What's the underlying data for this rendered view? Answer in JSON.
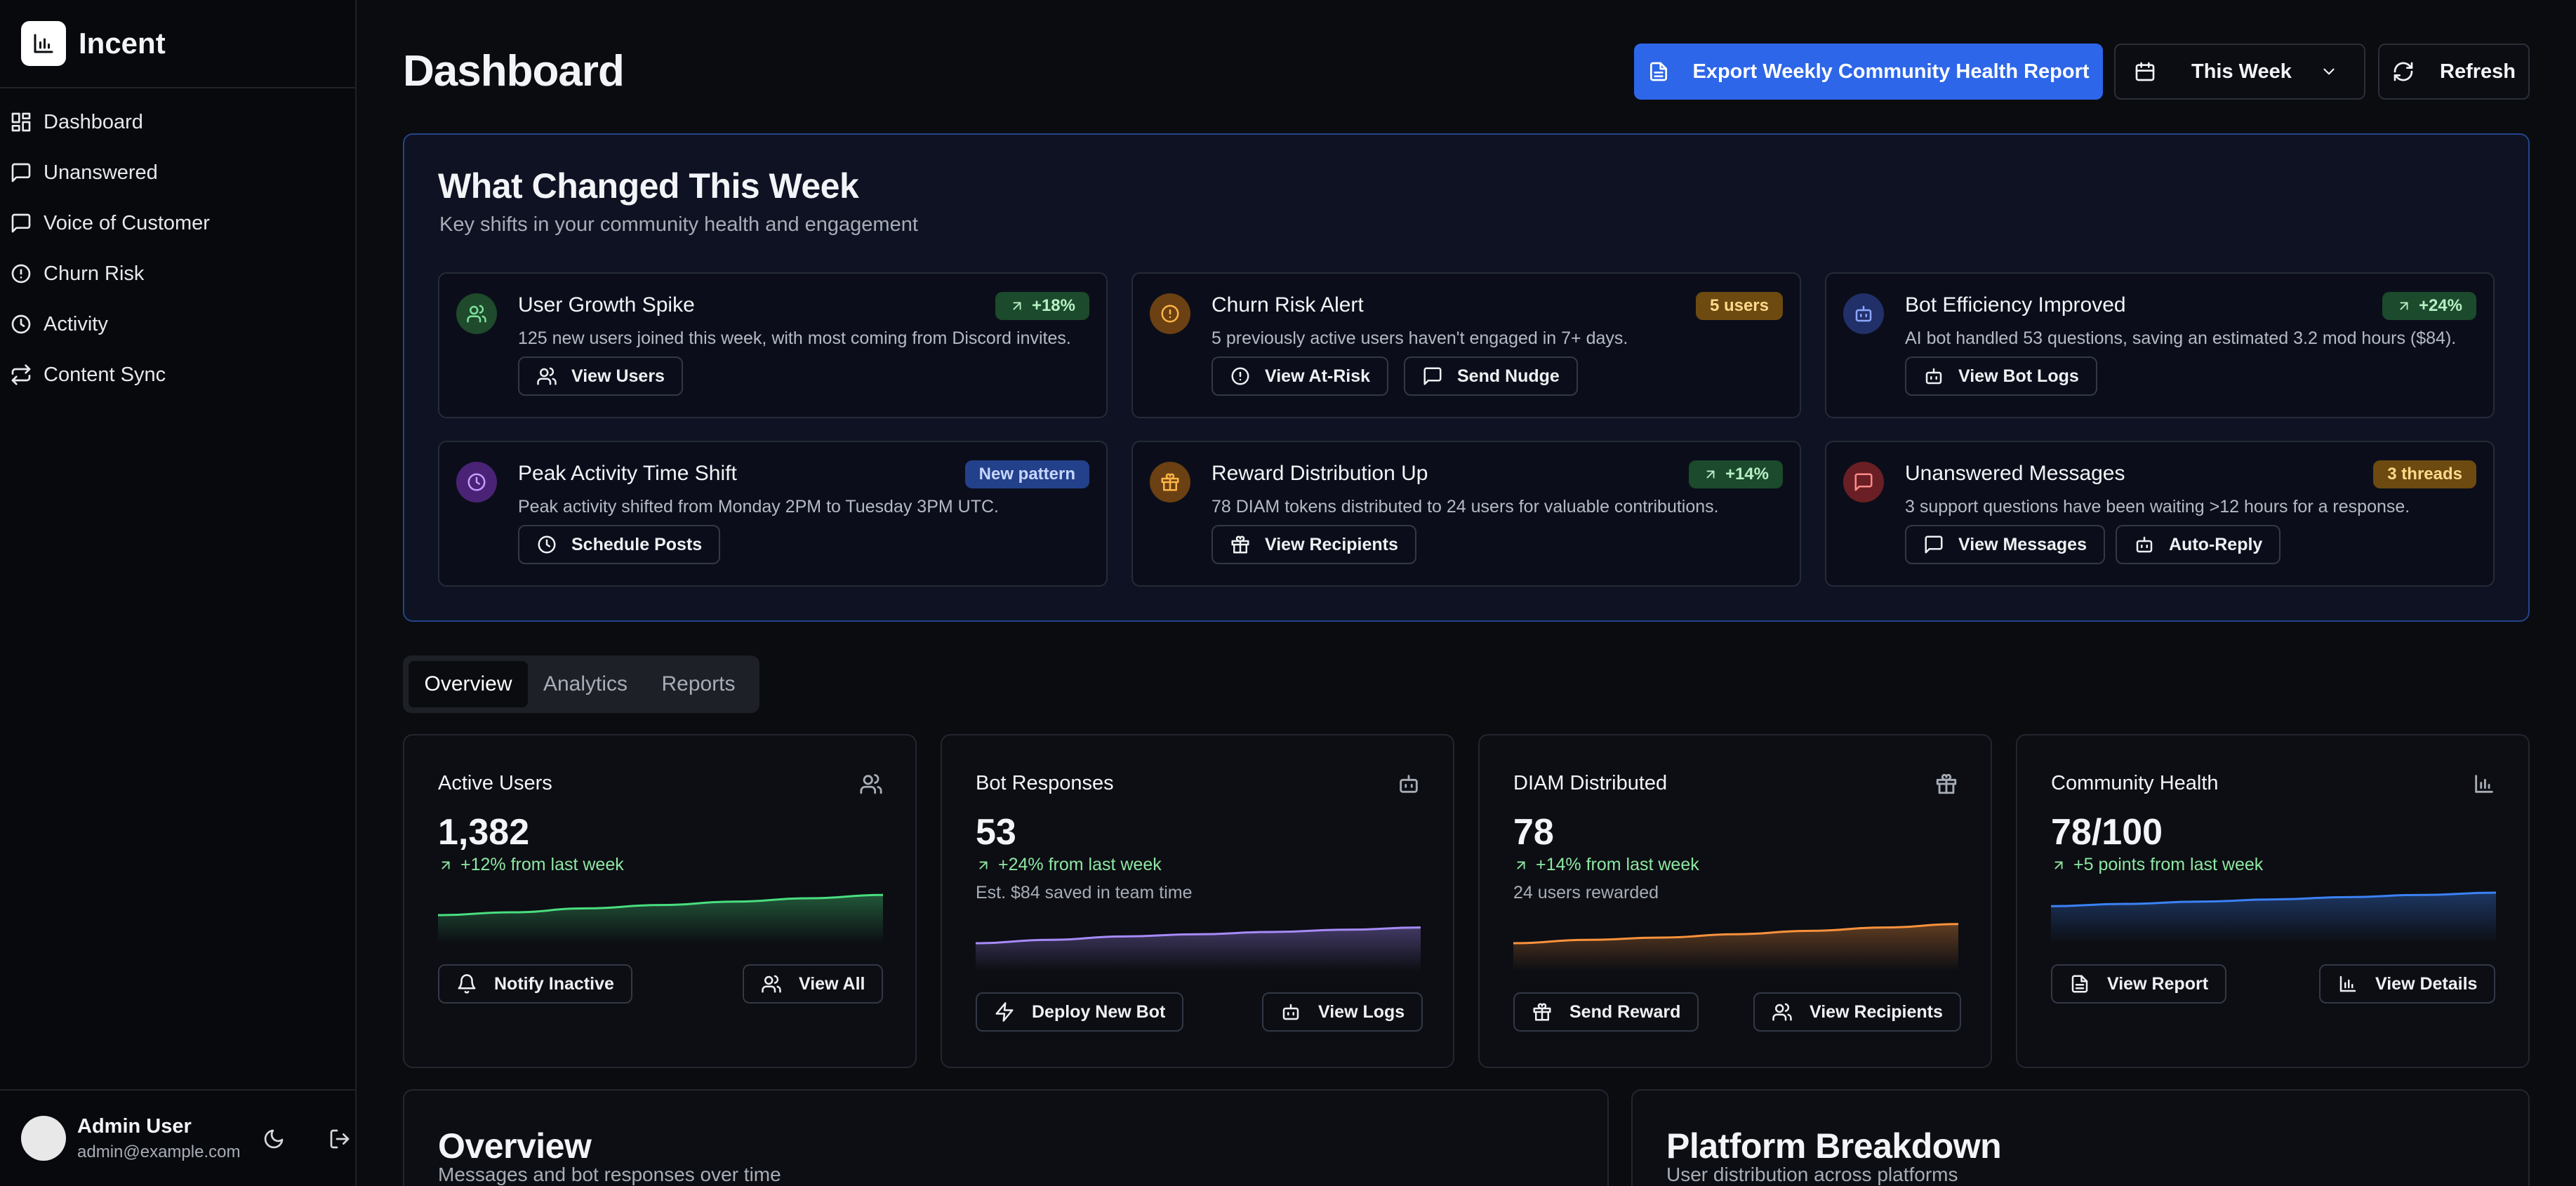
{
  "app": {
    "name": "Incent"
  },
  "colors": {
    "accent": "#2d66e8",
    "positive": "#8ee6a2",
    "background": "#0a0c10"
  },
  "sidebar": {
    "items": [
      {
        "label": "Dashboard",
        "icon": "dashboard-icon"
      },
      {
        "label": "Unanswered",
        "icon": "message-icon"
      },
      {
        "label": "Voice of Customer",
        "icon": "message-icon"
      },
      {
        "label": "Churn Risk",
        "icon": "alert-icon"
      },
      {
        "label": "Activity",
        "icon": "clock-icon"
      },
      {
        "label": "Content Sync",
        "icon": "sync-icon"
      }
    ],
    "user": {
      "name": "Admin User",
      "email": "admin@example.com"
    }
  },
  "header": {
    "title": "Dashboard",
    "export_label": "Export Weekly Community Health Report",
    "range_label": "This Week",
    "refresh_label": "Refresh"
  },
  "changes": {
    "title": "What Changed This Week",
    "subtitle": "Key shifts in your community health and engagement",
    "cards": [
      {
        "title": "User Growth Spike",
        "badge": "+18%",
        "desc": "125 new users joined this week, with most coming from Discord invites.",
        "actions": [
          "View Users"
        ]
      },
      {
        "title": "Churn Risk Alert",
        "badge": "5 users",
        "desc": "5 previously active users haven't engaged in 7+ days.",
        "actions": [
          "View At-Risk",
          "Send Nudge"
        ]
      },
      {
        "title": "Bot Efficiency Improved",
        "badge": "+24%",
        "desc": "AI bot handled 53 questions, saving an estimated 3.2 mod hours ($84).",
        "actions": [
          "View Bot Logs"
        ]
      },
      {
        "title": "Peak Activity Time Shift",
        "badge": "New pattern",
        "desc": "Peak activity shifted from Monday 2PM to Tuesday 3PM UTC.",
        "actions": [
          "Schedule Posts"
        ]
      },
      {
        "title": "Reward Distribution Up",
        "badge": "+14%",
        "desc": "78 DIAM tokens distributed to 24 users for valuable contributions.",
        "actions": [
          "View Recipients"
        ]
      },
      {
        "title": "Unanswered Messages",
        "badge": "3 threads",
        "desc": "3 support questions have been waiting >12 hours for a response.",
        "actions": [
          "View Messages",
          "Auto-Reply"
        ]
      }
    ]
  },
  "tabs": [
    "Overview",
    "Analytics",
    "Reports"
  ],
  "stats": [
    {
      "title": "Active Users",
      "value": "1,382",
      "change": "+12% from last week",
      "sub": "",
      "trend": [
        0.5,
        0.55,
        0.62,
        0.68,
        0.74,
        0.8,
        0.86
      ],
      "color": "#4ade80",
      "actions": [
        "Notify Inactive",
        "View All"
      ]
    },
    {
      "title": "Bot Responses",
      "value": "53",
      "change": "+24% from last week",
      "sub": "Est. $84 saved in team time",
      "trend": [
        0.5,
        0.56,
        0.62,
        0.66,
        0.7,
        0.74,
        0.78
      ],
      "color": "#a78bfa",
      "actions": [
        "Deploy New Bot",
        "View Logs"
      ]
    },
    {
      "title": "DIAM Distributed",
      "value": "78",
      "change": "+14% from last week",
      "sub": "24 users rewarded",
      "trend": [
        0.5,
        0.56,
        0.6,
        0.66,
        0.72,
        0.78,
        0.84
      ],
      "color": "#fb923c",
      "actions": [
        "Send Reward",
        "View Recipients"
      ]
    },
    {
      "title": "Community Health",
      "value": "78/100",
      "change": "+5 points from last week",
      "sub": "",
      "trend": [
        0.66,
        0.7,
        0.74,
        0.78,
        0.82,
        0.86,
        0.9
      ],
      "color": "#3b82f6",
      "actions": [
        "View Report",
        "View Details"
      ]
    }
  ],
  "bottom": [
    {
      "title": "Overview",
      "sub": "Messages and bot responses over time"
    },
    {
      "title": "Platform Breakdown",
      "sub": "User distribution across platforms"
    }
  ]
}
